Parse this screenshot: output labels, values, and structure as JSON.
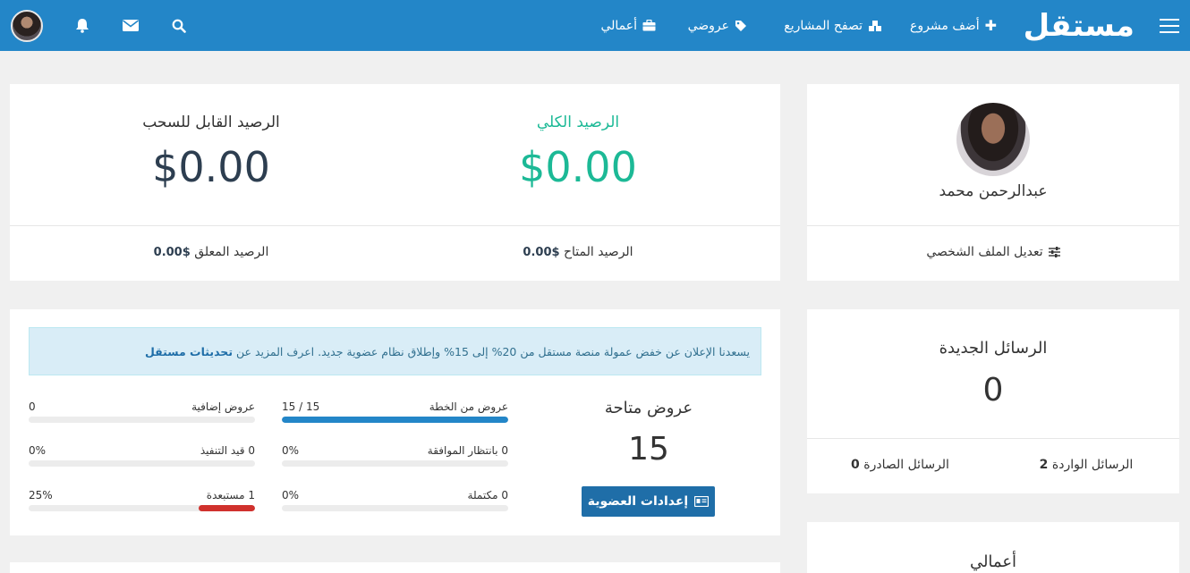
{
  "nav": {
    "logo": "مستقل",
    "add_project": "أضف مشروع",
    "browse_projects": "تصفح المشاريع",
    "my_bids": "عروضي",
    "my_jobs": "أعمالي",
    "icons": {
      "menu": "hamburger-menu-icon",
      "add": "plus-icon",
      "browse": "cubes-icon",
      "bids": "tag-icon",
      "jobs": "briefcase-icon",
      "search": "search-icon",
      "mail": "envelope-icon",
      "bell": "bell-icon"
    }
  },
  "profile": {
    "name": "عبدالرحمن محمد",
    "edit_profile": "تعديل الملف الشخصي"
  },
  "balance": {
    "total_label": "الرصيد الكلي",
    "total_value": "$0.00",
    "withdrawable_label": "الرصيد القابل للسحب",
    "withdrawable_value": "$0.00",
    "available_label": "الرصيد المتاح",
    "available_value": "$0.00",
    "pending_label": "الرصيد المعلق",
    "pending_value": "$0.00"
  },
  "messages": {
    "title": "الرسائل الجديدة",
    "count": "0",
    "inbox_label": "الرسائل الواردة",
    "inbox_count": "2",
    "outbox_label": "الرسائل الصادرة",
    "outbox_count": "0"
  },
  "my_jobs_card": {
    "title": "أعمالي"
  },
  "bids": {
    "announcement_text": "يسعدنا الإعلان عن خفض عمولة منصة مستقل من 20% إلى 15% وإطلاق نظام عضوية جديد. اعرف المزيد عن",
    "announcement_link": "تحديثات مستقل",
    "available_title": "عروض متاحة",
    "available_count": "15",
    "membership_button": "إعدادات العضوية",
    "stats": [
      {
        "label": "عروض من الخطة",
        "value": "15 / 15",
        "progress": 1.0,
        "color": "#2386c8"
      },
      {
        "label": "عروض إضافية",
        "value": "0",
        "progress": 0,
        "color": "#2386c8"
      },
      {
        "label": "0 بانتظار الموافقة",
        "value": "0%",
        "progress": 0,
        "color": "#2386c8"
      },
      {
        "label": "0 قيد التنفيذ",
        "value": "0%",
        "progress": 0,
        "color": "#2386c8"
      },
      {
        "label": "0 مكتملة",
        "value": "0%",
        "progress": 0,
        "color": "#2386c8"
      },
      {
        "label": "1 مستبعدة",
        "value": "25%",
        "progress": 0.25,
        "color": "#d0312d"
      }
    ]
  },
  "colors": {
    "primary": "#2386c8",
    "success": "#1cb996",
    "dark_value": "#2d3e50",
    "danger": "#d0312d"
  }
}
